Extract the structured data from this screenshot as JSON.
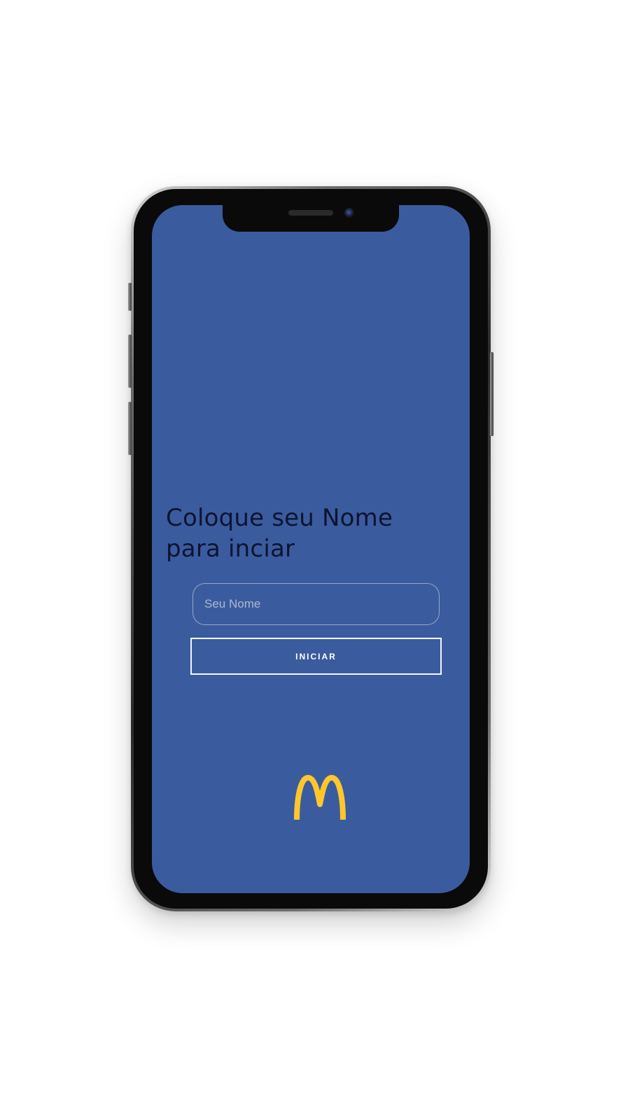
{
  "app": {
    "screen_background": "#3a5c9e",
    "accent_color": "#ffc72c"
  },
  "login": {
    "title_line1": "Coloque seu Nome",
    "title_line2": "para inciar",
    "name_input_placeholder": "Seu Nome",
    "name_input_value": "",
    "start_button_label": "INICIAR"
  },
  "logo": {
    "icon": "golden-arches-logo"
  }
}
